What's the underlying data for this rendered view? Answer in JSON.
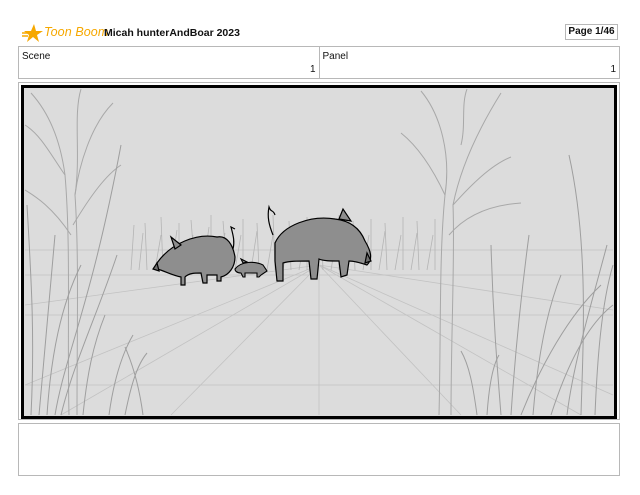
{
  "header": {
    "logo": {
      "text": "Toon Boom",
      "accent_color": "#f6a800"
    },
    "project_title": "Micah hunterAndBoar 2023",
    "page_indicator": "Page  1/46"
  },
  "panel_info": {
    "scene_label": "Scene",
    "scene_value": "1",
    "panel_label": "Panel",
    "panel_value": "1"
  },
  "storyboard_frame": {
    "scene_content": [
      "wild-boar-adult",
      "boar-piglet",
      "wild-boar-adult",
      "tall-grass",
      "bare-trees"
    ]
  },
  "notes": {
    "text": ""
  }
}
